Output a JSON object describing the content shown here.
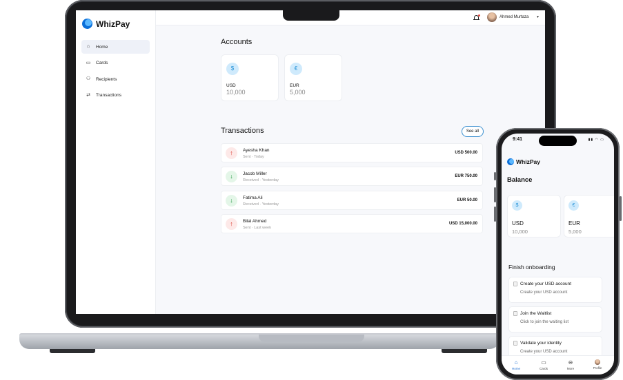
{
  "desktop": {
    "brand": "WhizPay",
    "nav": [
      {
        "label": "Home",
        "icon": "home-icon",
        "active": true
      },
      {
        "label": "Cards",
        "icon": "card-icon"
      },
      {
        "label": "Recipients",
        "icon": "users-icon"
      },
      {
        "label": "Transactions",
        "icon": "transfer-icon"
      }
    ],
    "user": {
      "name": "Ahmed Murtaza"
    },
    "accounts_title": "Accounts",
    "accounts": [
      {
        "symbol": "$",
        "code": "USD",
        "amount": "10,000"
      },
      {
        "symbol": "€",
        "code": "EUR",
        "amount": "5,000"
      }
    ],
    "transactions_title": "Transactions",
    "see_all": "See all",
    "transactions": [
      {
        "name": "Ayesha Khan",
        "type": "Sent",
        "when": "Today",
        "amount": "USD 500.00",
        "direction": "out"
      },
      {
        "name": "Jacob Miller",
        "type": "Received",
        "when": "Yesterday",
        "amount": "EUR 750.00",
        "direction": "in"
      },
      {
        "name": "Fatima Ali",
        "type": "Received",
        "when": "Yesterday",
        "amount": "EUR 50.00",
        "direction": "in"
      },
      {
        "name": "Bilal Ahmed",
        "type": "Sent",
        "when": "Last week",
        "amount": "USD 15,000.00",
        "direction": "out"
      }
    ]
  },
  "mobile": {
    "time": "9:41",
    "brand": "WhizPay",
    "balance_title": "Balance",
    "accounts": [
      {
        "symbol": "$",
        "code": "USD",
        "amount": "10,000"
      },
      {
        "symbol": "€",
        "code": "EUR",
        "amount": "5,000"
      }
    ],
    "onboarding_title": "Finish onboarding",
    "tasks": [
      {
        "title": "Create your USD account",
        "subtitle": "Create your USD account"
      },
      {
        "title": "Join the Waitlist",
        "subtitle": "Click to join the waiting list"
      },
      {
        "title": "Validate your identity",
        "subtitle": "Create your USD account"
      }
    ],
    "tabs": [
      {
        "label": "Home",
        "icon": "home-icon",
        "active": true
      },
      {
        "label": "Cards",
        "icon": "card-icon"
      },
      {
        "label": "More",
        "icon": "more-icon"
      },
      {
        "label": "Profile",
        "icon": "avatar"
      }
    ]
  },
  "colors": {
    "accent": "#1f6fd2",
    "sent": "#d9362b",
    "received": "#2a9a47",
    "icon_bg": "#cfeafc"
  }
}
